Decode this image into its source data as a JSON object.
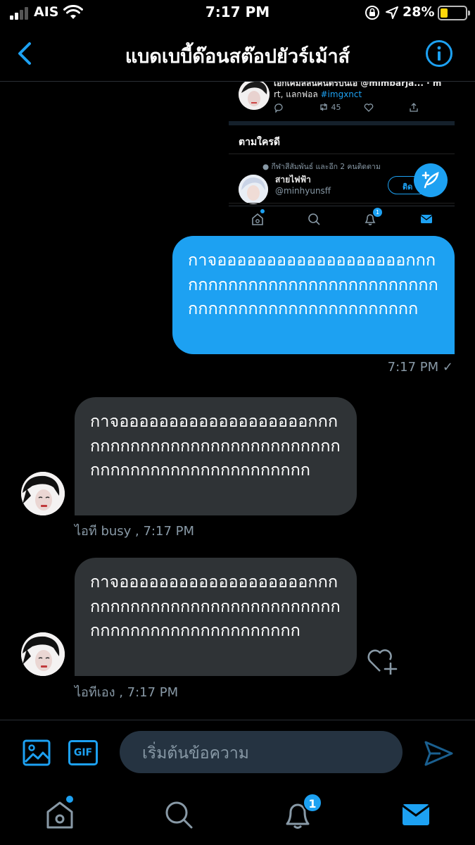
{
  "status_bar": {
    "carrier": "AIS",
    "time": "7:17 PM",
    "battery_percent_label": "28%",
    "battery_level": 0.28
  },
  "header": {
    "title": "แบดเบบี้ด๊อนสต๊อปยัวร์เม้าส์",
    "back_icon": "chevron-left-icon",
    "info_icon": "info-circle-icon"
  },
  "shared_screenshot": {
    "tweet_header_partial": "เอกเคมัลลันคนิตรบันเอ @mimbarja... · m",
    "tweet_text_prefix": "rt, แลกฟอล ",
    "tweet_hashtag": "#imgxnct",
    "retweet_count": "45",
    "who_to_follow_heading": "ตามใครดี",
    "suggestion_context": "กีฬาสีสัมพันธ์ และอีก 2 คนติดตาม",
    "suggestion_name": "สายไฟฟ้า",
    "suggestion_handle": "@minhyunsff",
    "follow_button_label": "ติด",
    "notification_badge": "1"
  },
  "messages": [
    {
      "direction": "outgoing",
      "text": "กาจอออออออออออออออออออกกกกกกกกกกกกกกกกกกกกกกกกกกกกกกกกกกกกกกกกกกกกกกกกกกก",
      "meta": "7:17 PM ✓"
    },
    {
      "direction": "incoming",
      "text": "กาจอออออออออออออออออออกกกกกกกกกกกกกกกกกกกกกกกกกกกกกกกกกกกกกกกกกกกกกกกกกก",
      "meta": "ไอที busy  , 7:17 PM"
    },
    {
      "direction": "incoming",
      "text": "กาจอออออออออออออออออออกกกกกกกกกกกกกกกกกกกกกกกกกกกกกกกกกกกกกกกกกกกกกกกกก",
      "meta": "ไอทีเอง  , 7:17 PM"
    }
  ],
  "compose": {
    "placeholder": "เริ่มต้นข้อความ",
    "gif_label": "GIF"
  },
  "bottom_nav": {
    "notifications_badge": "1",
    "items": [
      "home-icon",
      "search-icon",
      "notifications-icon",
      "messages-icon"
    ]
  },
  "colors": {
    "accent": "#1da1f2",
    "incoming_bubble": "#2f3336",
    "background": "#000000",
    "muted_text": "#8899a6",
    "battery_fill": "#ffd60a"
  }
}
